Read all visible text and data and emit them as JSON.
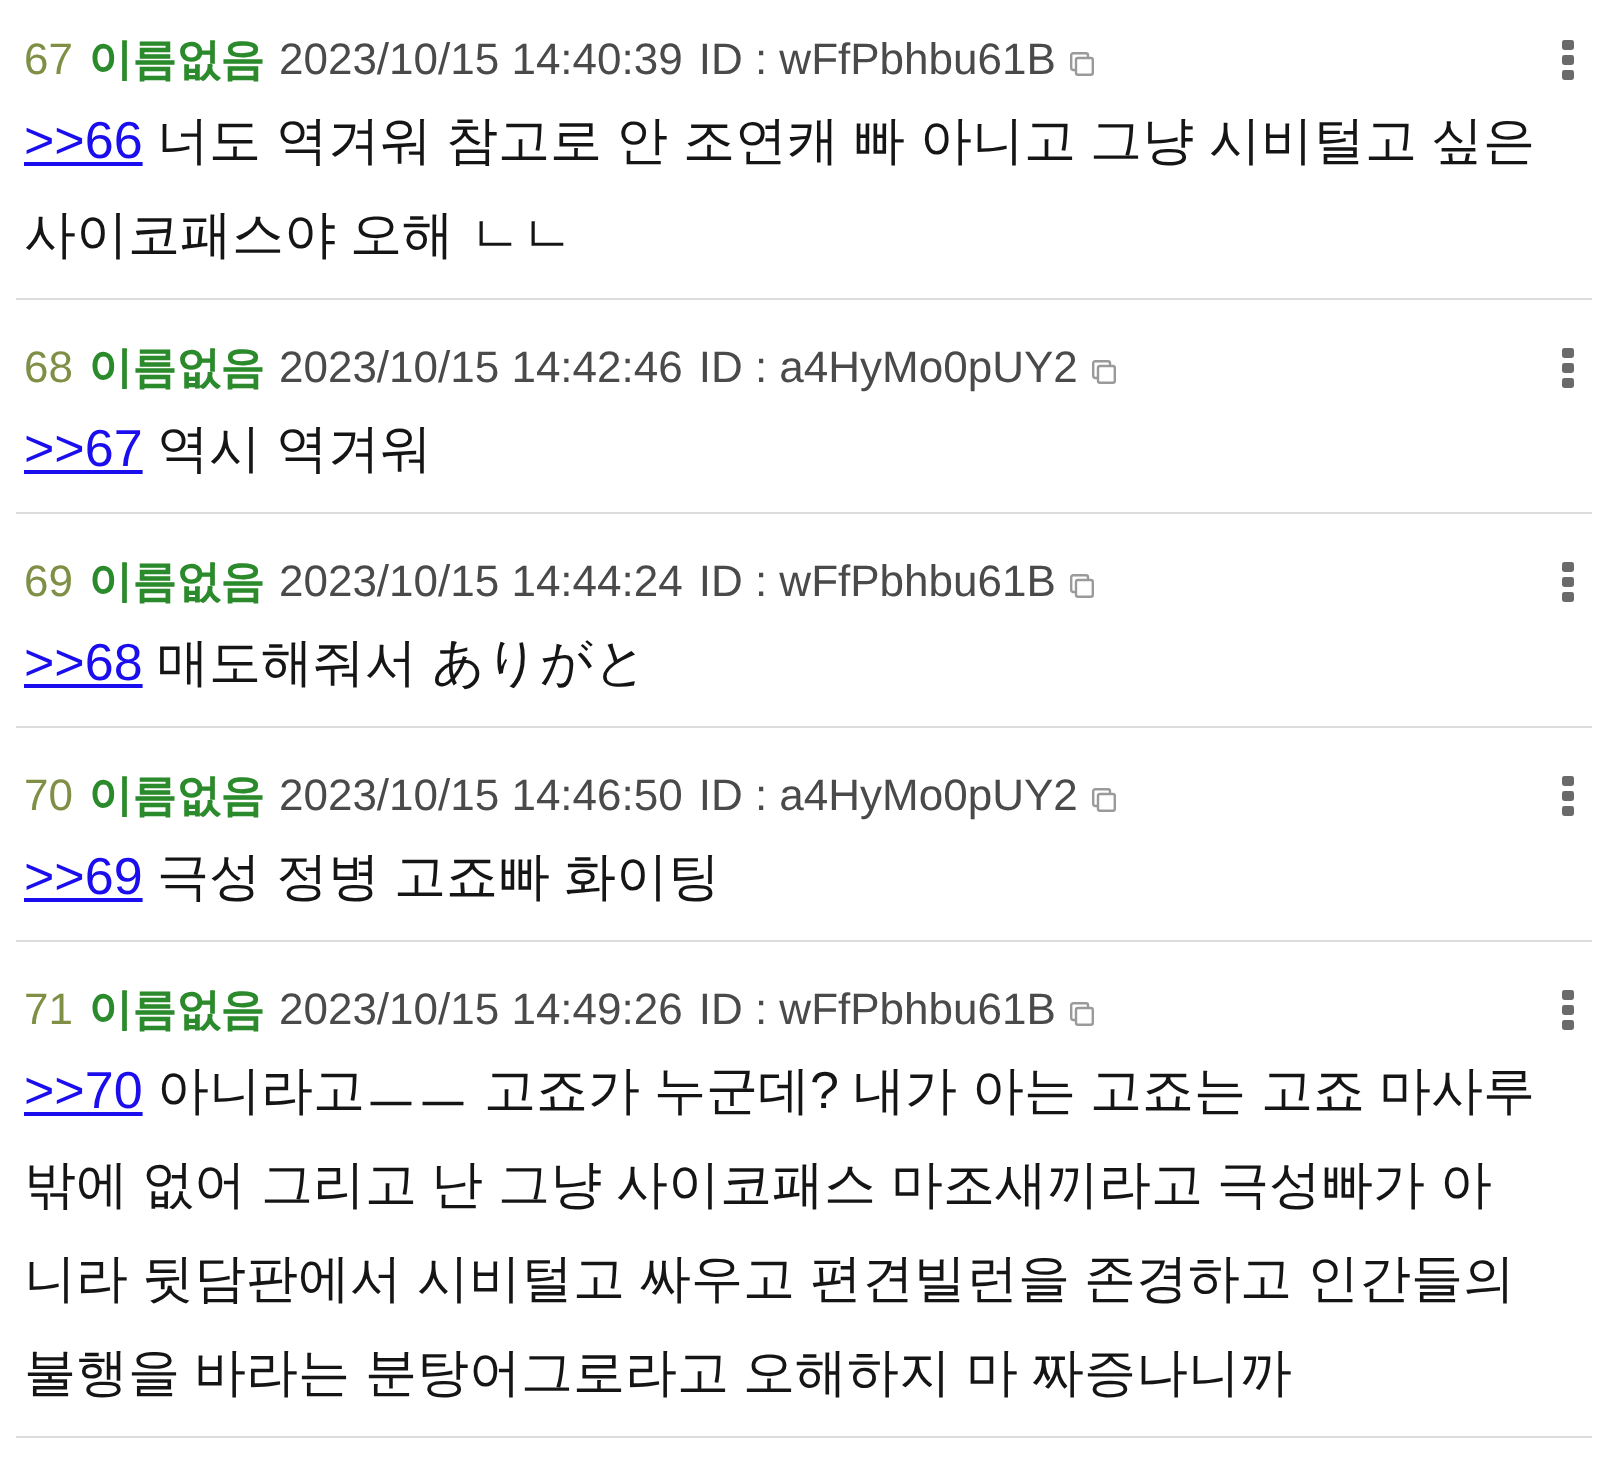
{
  "posts": [
    {
      "number": "67",
      "name": "이름없음",
      "date": "2023/10/15 14:40:39",
      "id": "ID : wFfPbhbu61B",
      "reply_to": ">>66",
      "text": "너도 역겨워 참고로 안 조연캐 빠 아니고 그냥 시비털고 싶은 사이코패스야 오해 ㄴㄴ"
    },
    {
      "number": "68",
      "name": "이름없음",
      "date": "2023/10/15 14:42:46",
      "id": "ID : a4HyMo0pUY2",
      "reply_to": ">>67",
      "text": "역시 역겨워"
    },
    {
      "number": "69",
      "name": "이름없음",
      "date": "2023/10/15 14:44:24",
      "id": "ID : wFfPbhbu61B",
      "reply_to": ">>68",
      "text": "매도해줘서 ありがと"
    },
    {
      "number": "70",
      "name": "이름없음",
      "date": "2023/10/15 14:46:50",
      "id": "ID : a4HyMo0pUY2",
      "reply_to": ">>69",
      "text": "극성 정병 고죠빠 화이팅"
    },
    {
      "number": "71",
      "name": "이름없음",
      "date": "2023/10/15 14:49:26",
      "id": "ID : wFfPbhbu61B",
      "reply_to": ">>70",
      "text": "아니라고ㅡㅡ 고죠가 누군데? 내가 아는 고죠는 고죠 마사루밖에 없어 그리고 난 그냥 사이코패스 마조새끼라고 극성빠가 아니라 뒷담판에서 시비털고 싸우고 편견빌런을 존경하고 인간들의 불행을 바라는 분탕어그로라고 오해하지 마 짜증나니까"
    }
  ]
}
